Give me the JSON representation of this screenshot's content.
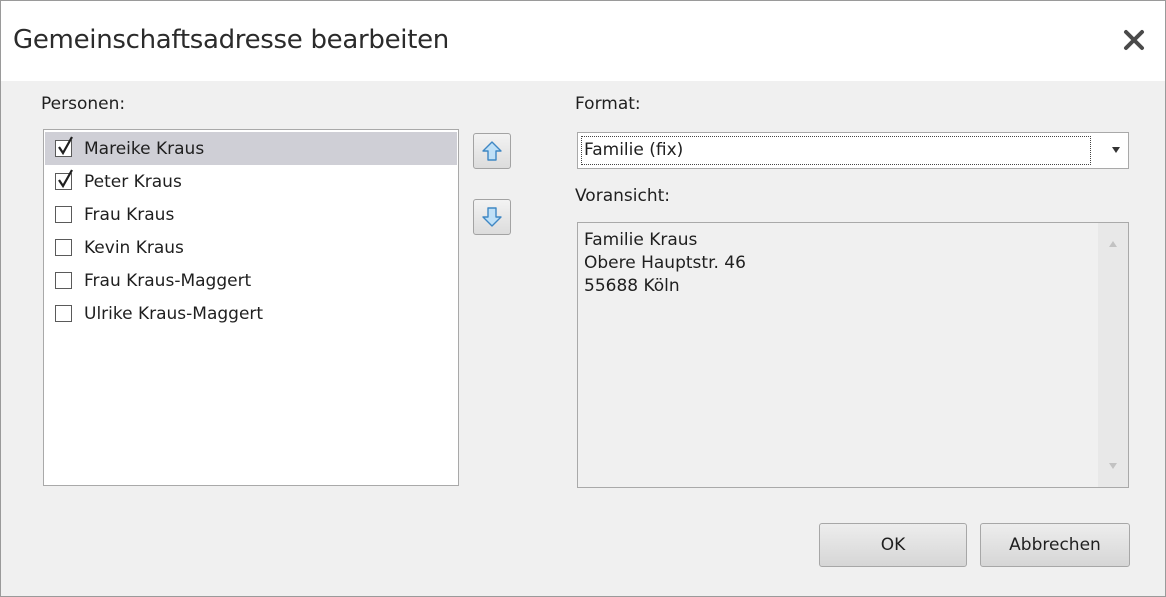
{
  "window": {
    "title": "Gemeinschaftsadresse bearbeiten",
    "close_icon": "close-icon"
  },
  "persons": {
    "label": "Personen:",
    "items": [
      {
        "name": "Mareike Kraus",
        "checked": true,
        "selected": true
      },
      {
        "name": "Peter Kraus",
        "checked": true,
        "selected": false
      },
      {
        "name": "Frau Kraus",
        "checked": false,
        "selected": false
      },
      {
        "name": "Kevin Kraus",
        "checked": false,
        "selected": false
      },
      {
        "name": "Frau Kraus-Maggert",
        "checked": false,
        "selected": false
      },
      {
        "name": "Ulrike Kraus-Maggert",
        "checked": false,
        "selected": false
      }
    ]
  },
  "reorder": {
    "up_icon": "arrow-up-icon",
    "down_icon": "arrow-down-icon"
  },
  "format": {
    "label": "Format:",
    "value": "Familie (fix)"
  },
  "preview": {
    "label": "Voransicht:",
    "lines": [
      "Familie Kraus",
      "Obere Hauptstr. 46",
      "55688 Köln"
    ]
  },
  "buttons": {
    "ok": "OK",
    "cancel": "Abbrechen"
  },
  "colors": {
    "selected_row": "#cfcfd6",
    "arrow_fill": "#bfe0f7",
    "arrow_stroke": "#3f87c4"
  }
}
